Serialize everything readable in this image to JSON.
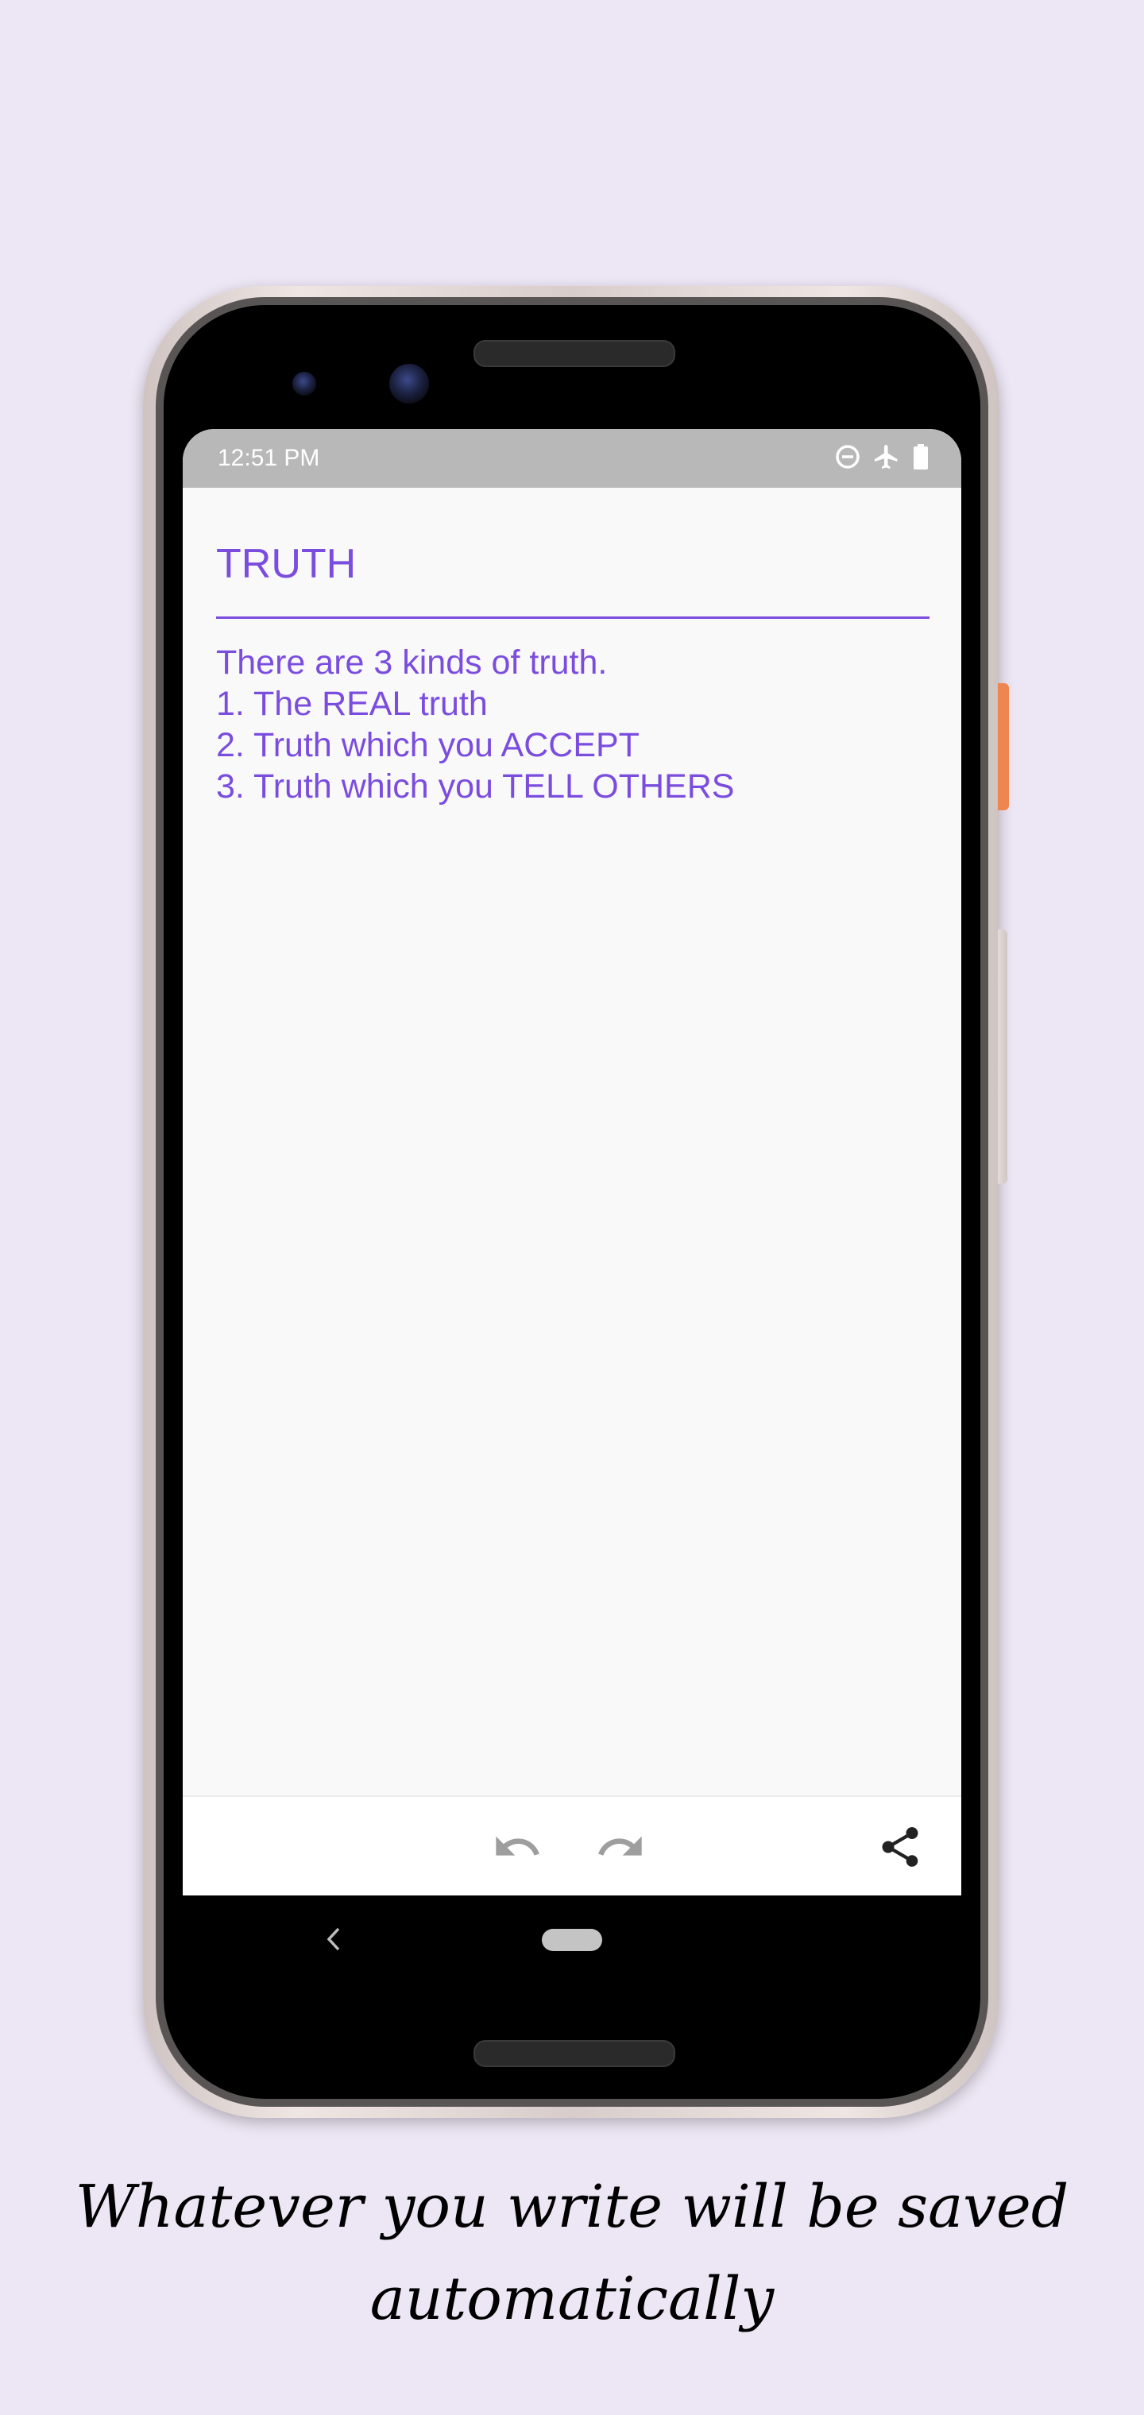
{
  "status_bar": {
    "time": "12:51 PM",
    "icons": [
      "do-not-disturb-icon",
      "airplane-mode-icon",
      "battery-icon"
    ]
  },
  "note": {
    "title": "TRUTH",
    "body_lines": [
      "There are 3 kinds of truth.",
      "1. The REAL truth",
      "2. Truth which you ACCEPT",
      "3. Truth which you TELL OTHERS"
    ]
  },
  "toolbar": {
    "icons": [
      "undo-icon",
      "redo-icon",
      "share-icon"
    ]
  },
  "caption": {
    "line1": "Whatever you write will be saved",
    "line2": "automatically"
  },
  "colors": {
    "accent": "#7b4ddf",
    "background": "#ede6f4",
    "status_bar": "#b8b8b8"
  }
}
